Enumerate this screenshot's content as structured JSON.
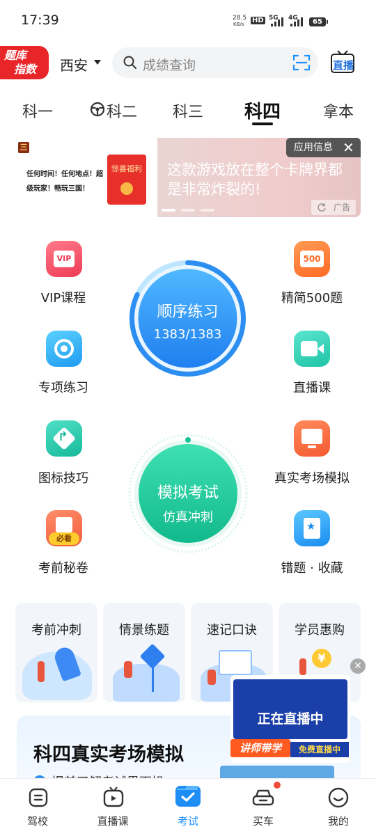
{
  "status_bar": {
    "time": "17:39",
    "net_speed_value": "28.5",
    "net_speed_unit": "KB/s",
    "hd": "HD",
    "net1": "5G",
    "net2": "4G",
    "battery": "65"
  },
  "header": {
    "logo_line1": "题库",
    "logo_line2": "指数",
    "city": "西安",
    "search_placeholder": "成绩查询",
    "live_label": "直播"
  },
  "tabs": [
    {
      "label": "科一",
      "active": false
    },
    {
      "label": "科二",
      "active": false
    },
    {
      "label": "科三",
      "active": false
    },
    {
      "label": "科四",
      "active": true
    },
    {
      "label": "拿本",
      "active": false
    }
  ],
  "ad": {
    "left_text": "任何时间！任何地点！超级玩家！畅玩三国！",
    "red_packet_text": "惊喜福利",
    "main_text": "这款游戏放在整个卡牌界都是非常炸裂的!",
    "info_label": "应用信息",
    "ad_label": "广告"
  },
  "practice": {
    "sequential": {
      "title": "顺序练习",
      "progress": "1383/1383",
      "progress_value": 1.0
    },
    "mock": {
      "title": "模拟考试",
      "subtitle": "仿真冲刺"
    }
  },
  "grid_left": [
    {
      "label": "VIP课程",
      "icon": "vip-icon",
      "icon_text": "VIP"
    },
    {
      "label": "专项练习",
      "icon": "target-icon"
    },
    {
      "label": "图标技巧",
      "icon": "turn-sign-icon"
    },
    {
      "label": "考前秘卷",
      "icon": "exam-paper-icon",
      "icon_text": "必看"
    }
  ],
  "grid_right": [
    {
      "label": "精简500题",
      "icon": "500-icon",
      "icon_text": "500"
    },
    {
      "label": "直播课",
      "icon": "video-icon"
    },
    {
      "label": "真实考场模拟",
      "icon": "monitor-icon"
    },
    {
      "label": "错题 · 收藏",
      "icon": "bookmark-icon"
    }
  ],
  "cards": [
    {
      "label": "考前冲刺"
    },
    {
      "label": "情景练题"
    },
    {
      "label": "速记口诀"
    },
    {
      "label": "学员惠购",
      "coin": "¥"
    }
  ],
  "banner": {
    "title": "科四真实考场模拟",
    "subtitle": "提前了解考试界面操"
  },
  "live_popup": {
    "screen_text": "正在直播中",
    "tag1": "讲师带学",
    "tag2": "免费直播中"
  },
  "bottom_nav": [
    {
      "label": "驾校",
      "icon": "school-icon",
      "active": false
    },
    {
      "label": "直播课",
      "icon": "tv-icon",
      "active": false
    },
    {
      "label": "考试",
      "icon": "exam-icon",
      "active": true
    },
    {
      "label": "买车",
      "icon": "car-icon",
      "active": false
    },
    {
      "label": "我的",
      "icon": "profile-icon",
      "active": false
    }
  ],
  "colors": {
    "accent_blue": "#1e90ff",
    "teal": "#1fc99a",
    "logo_red": "#e8262a",
    "ad_bg": "#ecd0cf"
  }
}
